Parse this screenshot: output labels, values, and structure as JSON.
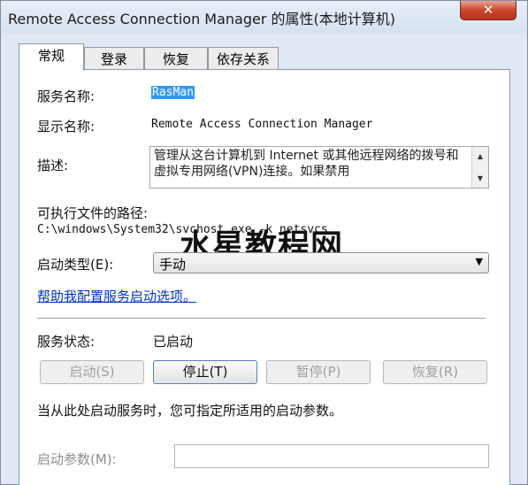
{
  "window": {
    "title": "Remote Access Connection Manager 的属性(本地计算机)",
    "close_icon": "close-icon"
  },
  "tabs": [
    {
      "label": "常规",
      "active": true
    },
    {
      "label": "登录",
      "active": false
    },
    {
      "label": "恢复",
      "active": false
    },
    {
      "label": "依存关系",
      "active": false
    }
  ],
  "general": {
    "service_name_label": "服务名称:",
    "service_name_value": "RasMan",
    "display_name_label": "显示名称:",
    "display_name_value": "Remote Access Connection Manager",
    "description_label": "描述:",
    "description_value": "管理从这台计算机到 Internet 或其他远程网络的拨号和虚拟专用网络(VPN)连接。如果禁用",
    "exe_path_label": "可执行文件的路径:",
    "exe_path_value": "C:\\windows\\System32\\svchost.exe -k netsvcs",
    "startup_type_label": "启动类型(E):",
    "startup_type_value": "手动",
    "help_link": "帮助我配置服务启动选项。",
    "service_status_label": "服务状态:",
    "service_status_value": "已启动",
    "hint_text": "当从此处启动服务时，您可指定所适用的启动参数。",
    "start_params_label": "启动参数(M):",
    "start_params_value": ""
  },
  "buttons": {
    "start": "启动(S)",
    "stop": "停止(T)",
    "pause": "暂停(P)",
    "resume": "恢复(R)"
  },
  "watermark": "水星教程网",
  "colors": {
    "selection": "#3399ff",
    "link": "#0033cc",
    "close_button": "#c9462c"
  }
}
